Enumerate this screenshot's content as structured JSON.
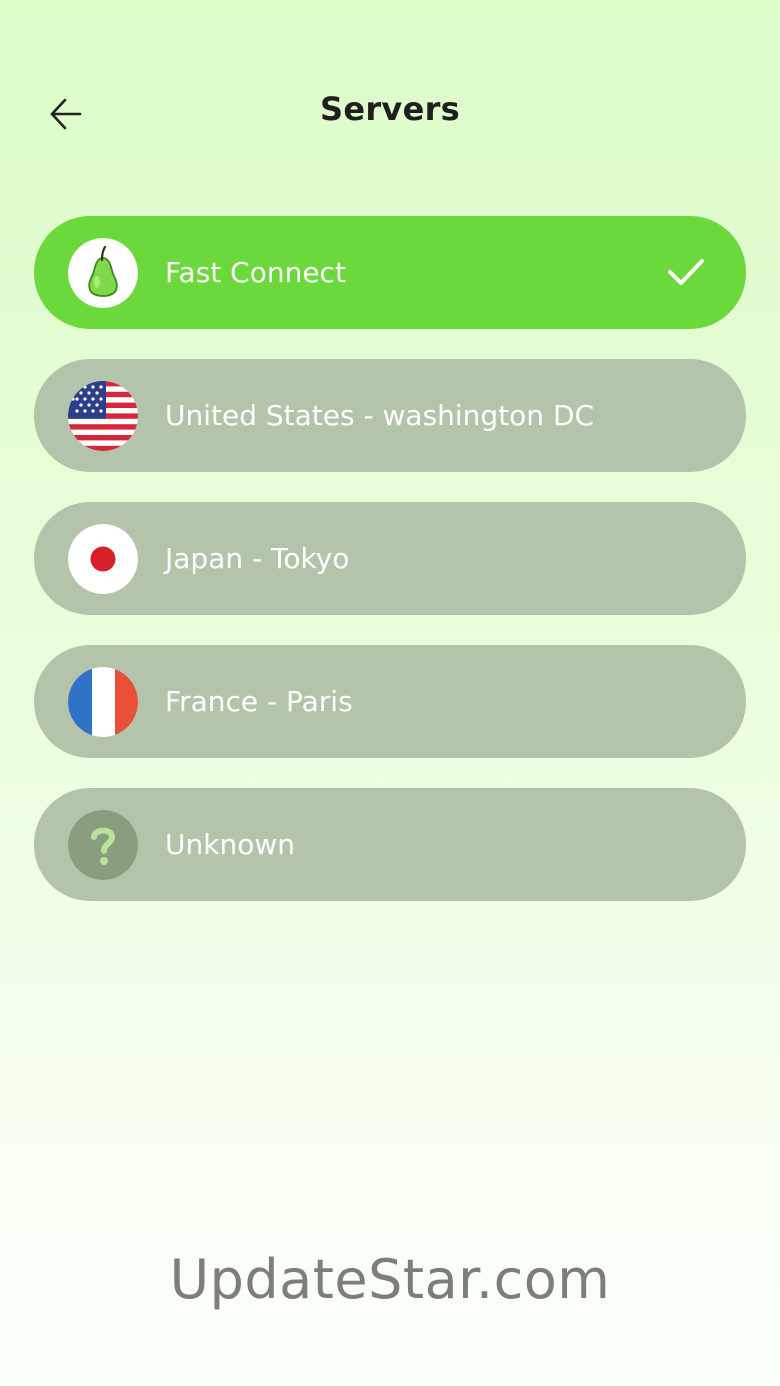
{
  "header": {
    "title": "Servers",
    "back_icon": "arrow-left-icon"
  },
  "colors": {
    "selected_item": "#6bd83c",
    "item_background": "#b3c4aa",
    "item_text": "#ffffff",
    "title_text": "#1f1f1f"
  },
  "servers": [
    {
      "label": "Fast Connect",
      "icon": "pear-icon",
      "selected": true
    },
    {
      "label": "United States - washington DC",
      "icon": "us-flag-icon",
      "selected": false
    },
    {
      "label": "Japan - Tokyo",
      "icon": "japan-flag-icon",
      "selected": false
    },
    {
      "label": "France - Paris",
      "icon": "france-flag-icon",
      "selected": false
    },
    {
      "label": "Unknown",
      "icon": "question-icon",
      "selected": false
    }
  ],
  "watermark": "UpdateStar.com"
}
